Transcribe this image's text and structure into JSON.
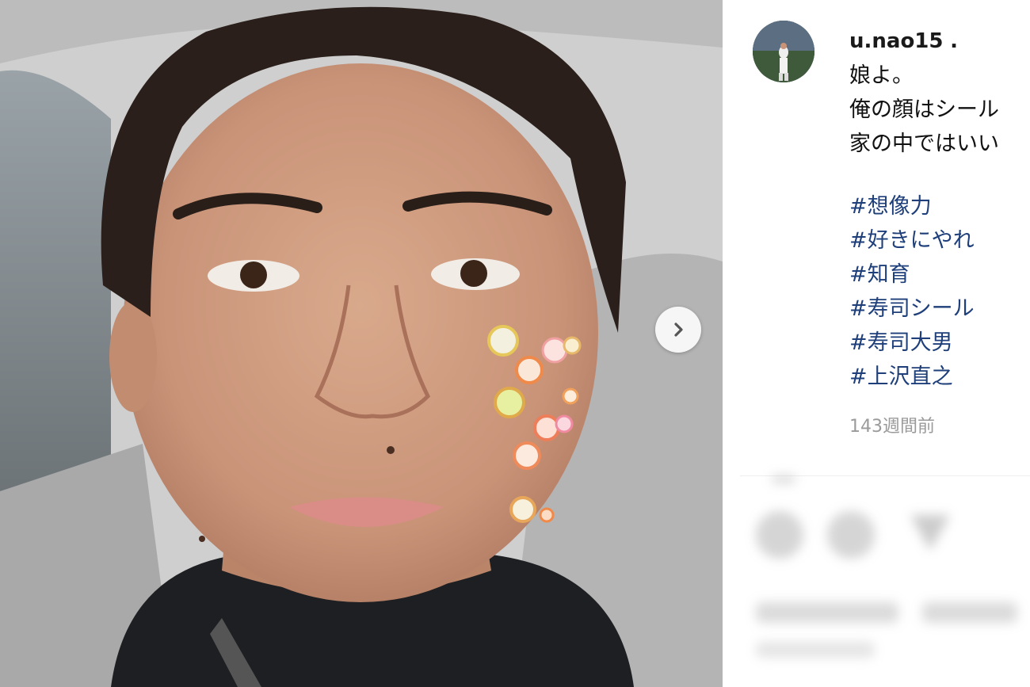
{
  "post": {
    "username": "u.nao15",
    "username_suffix": ".",
    "caption_lines": [
      "娘よ。",
      "俺の顔はシール",
      "家の中ではいい"
    ],
    "hashtags": [
      "#想像力",
      "#好きにやれ",
      "#知育",
      "#寿司シール",
      "#寿司大男",
      "#上沢直之"
    ],
    "timestamp": "143週間前"
  },
  "icons": {
    "next": "chevron-right-icon",
    "avatar": "profile-avatar"
  },
  "colors": {
    "hashtag": "#1e3f7a",
    "timestamp": "#9a9a9a"
  }
}
